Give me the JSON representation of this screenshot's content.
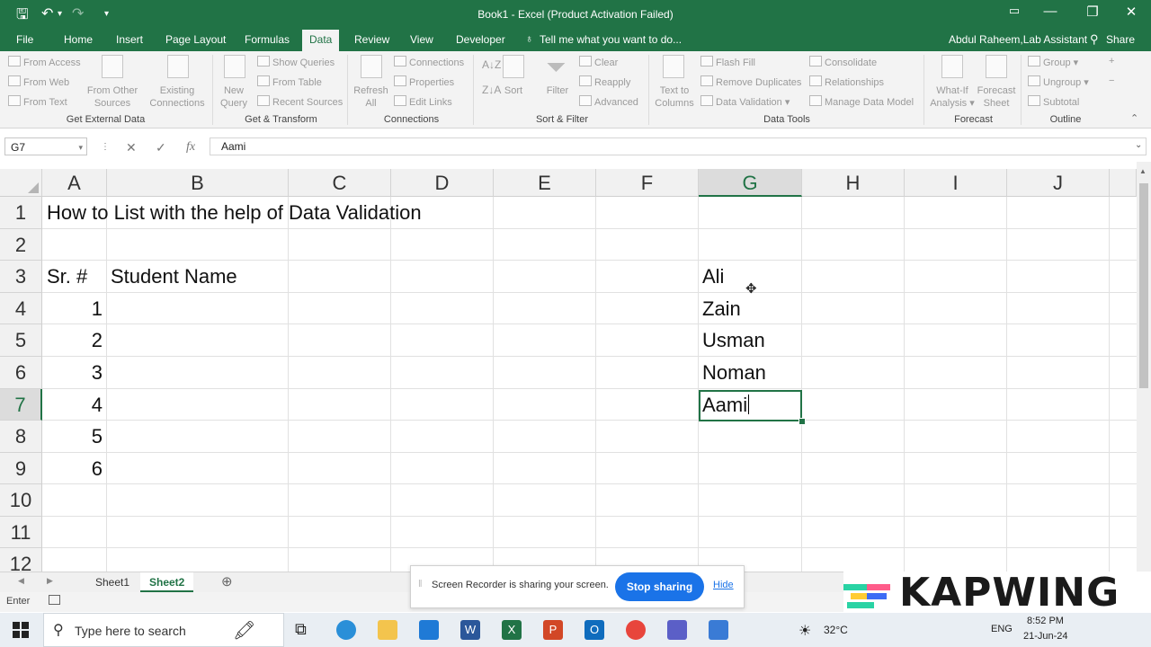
{
  "window": {
    "title": "Book1  -  Excel (Product Activation Failed)",
    "account": "Abdul Raheem,Lab Assistant",
    "share_label": "Share",
    "tell_me": "Tell me what you want to do...",
    "controls": [
      "—",
      "❐",
      "✕"
    ]
  },
  "tabs": [
    {
      "label": "File"
    },
    {
      "label": "Home"
    },
    {
      "label": "Insert"
    },
    {
      "label": "Page Layout"
    },
    {
      "label": "Formulas"
    },
    {
      "label": "Data"
    },
    {
      "label": "Review"
    },
    {
      "label": "View"
    },
    {
      "label": "Developer"
    }
  ],
  "ribbon": {
    "get_external": {
      "from_access": "From Access",
      "from_web": "From Web",
      "from_text": "From Text",
      "from_other_1": "From Other",
      "from_other_2": "Sources",
      "existing_1": "Existing",
      "existing_2": "Connections",
      "label": "Get External Data"
    },
    "get_transform": {
      "new_query_1": "New",
      "new_query_2": "Query",
      "show_queries": "Show Queries",
      "from_table": "From Table",
      "recent_sources": "Recent Sources",
      "label": "Get & Transform"
    },
    "connections": {
      "refresh_1": "Refresh",
      "refresh_2": "All",
      "connections": "Connections",
      "properties": "Properties",
      "edit_links": "Edit Links",
      "label": "Connections"
    },
    "sort_filter": {
      "sort": "Sort",
      "filter": "Filter",
      "clear": "Clear",
      "reapply": "Reapply",
      "advanced": "Advanced",
      "label": "Sort & Filter"
    },
    "data_tools": {
      "text_to_1": "Text to",
      "text_to_2": "Columns",
      "flash_fill": "Flash Fill",
      "remove_duplicates": "Remove Duplicates",
      "data_validation": "Data Validation",
      "consolidate": "Consolidate",
      "relationships": "Relationships",
      "manage_data_model": "Manage Data Model",
      "label": "Data Tools"
    },
    "forecast": {
      "what_if_1": "What-If",
      "what_if_2": "Analysis",
      "forecast_1": "Forecast",
      "forecast_2": "Sheet",
      "label": "Forecast"
    },
    "outline": {
      "group": "Group",
      "ungroup": "Ungroup",
      "subtotal": "Subtotal",
      "label": "Outline"
    }
  },
  "formula_bar": {
    "name_box": "G7",
    "value": "Aami",
    "cancel": "✕",
    "enter": "✓",
    "fx": "fx"
  },
  "columns": [
    "A",
    "B",
    "C",
    "D",
    "E",
    "F",
    "G",
    "H",
    "I",
    "J"
  ],
  "rows": [
    "1",
    "2",
    "3",
    "4",
    "5",
    "6",
    "7",
    "8",
    "9",
    "10",
    "11",
    "12"
  ],
  "cells": {
    "A1": "How to List with the help of Data Validation",
    "A3": "Sr. #",
    "B3": "Student Name",
    "A4": "1",
    "A5": "2",
    "A6": "3",
    "A7": "4",
    "A8": "5",
    "A9": "6",
    "G3": "Ali",
    "G4": "Zain",
    "G5": "Usman",
    "G6": "Noman",
    "G7": "Aami"
  },
  "sheets": [
    {
      "label": "Sheet1",
      "active": false
    },
    {
      "label": "Sheet2",
      "active": true
    }
  ],
  "status": {
    "mode": "Enter"
  },
  "share_popup": {
    "message": "Screen Recorder is sharing your screen.",
    "stop": "Stop sharing",
    "hide": "Hide"
  },
  "taskbar": {
    "search_placeholder": "Type here to search",
    "temp": "32°C",
    "lang": "ENG",
    "time": "8:52 PM",
    "date": "21-Jun-24"
  },
  "watermark": {
    "text": "KAPWING"
  },
  "colors": {
    "excel_green": "#217346",
    "share_blue": "#1a73e8"
  }
}
